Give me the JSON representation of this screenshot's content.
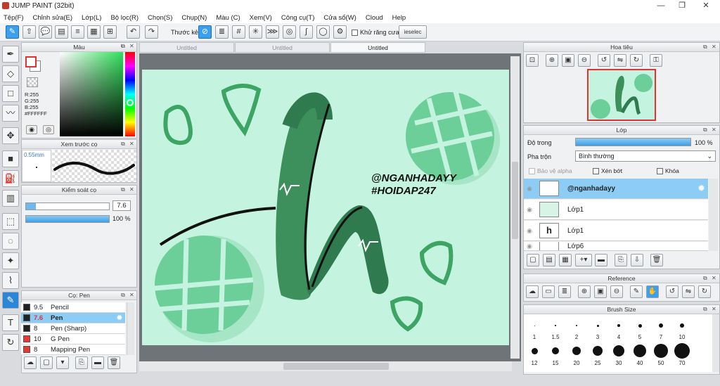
{
  "window": {
    "title": "JUMP PAINT (32bit)",
    "min": "—",
    "max": "❐",
    "close": "✕"
  },
  "menu": [
    "Tệp(F)",
    "Chỉnh sửa(E)",
    "Lớp(L)",
    "Bộ lọc(R)",
    "Chọn(S)",
    "Chụp(N)",
    "Màu (C)",
    "Xem(V)",
    "Công cụ(T)",
    "Cửa sổ(W)",
    "Cloud",
    "Help"
  ],
  "toolbar": {
    "ruler_label": "Thước kẻ",
    "antialias_label": "Khử răng cưa",
    "deselect_label": "ieselec"
  },
  "tabs": [
    "Untitled",
    "Untitled",
    "Untitled"
  ],
  "color_panel": {
    "title": "Màu",
    "r": "R:255",
    "g": "G:255",
    "b": "B:255",
    "hex": "#FFFFFF"
  },
  "brush_preview": {
    "title": "Xem trước cọ",
    "size": "0.55mm"
  },
  "brush_control": {
    "title": "Kiểm soát cọ",
    "size": "7.6",
    "opacity": "100 %"
  },
  "brush_list": {
    "title": "Cọ: Pen",
    "items": [
      {
        "size": "9.5",
        "name": "Pencil",
        "color": "#222222",
        "active": false
      },
      {
        "size": "7.6",
        "name": "Pen",
        "color": "#222222",
        "active": true
      },
      {
        "size": "8",
        "name": "Pen (Sharp)",
        "color": "#222222",
        "active": false
      },
      {
        "size": "10",
        "name": "G Pen",
        "color": "#e53935",
        "active": false
      },
      {
        "size": "8",
        "name": "Mapping Pen",
        "color": "#e53935",
        "active": false
      }
    ]
  },
  "navigator": {
    "title": "Hoa tiêu"
  },
  "layers": {
    "title": "Lớp",
    "opacity_label": "Độ trong",
    "opacity_value": "100 %",
    "blend_label": "Pha trộn",
    "blend_value": "Bình thường",
    "protect_alpha": "Bảo vệ alpha",
    "clip": "Xén bớt",
    "lock": "Khóa",
    "items": [
      "@nganhadayy",
      "Lớp1",
      "Lớp1",
      "Lớp6"
    ]
  },
  "reference": {
    "title": "Reference"
  },
  "brush_size": {
    "title": "Brush Size",
    "row1": [
      "1",
      "1.5",
      "2",
      "3",
      "4",
      "5",
      "7",
      "10"
    ],
    "row2": [
      "12",
      "15",
      "20",
      "25",
      "30",
      "40",
      "50",
      "70"
    ]
  },
  "artwork": {
    "line1": "@NGANHADAYY",
    "line2": "#HOIDAP247"
  },
  "colors": {
    "accent": "#3aa0ef",
    "paper": "#c4f3df",
    "green_dark": "#2f7a4f",
    "green_mid": "#3da563",
    "green_light": "#6fd39c"
  }
}
